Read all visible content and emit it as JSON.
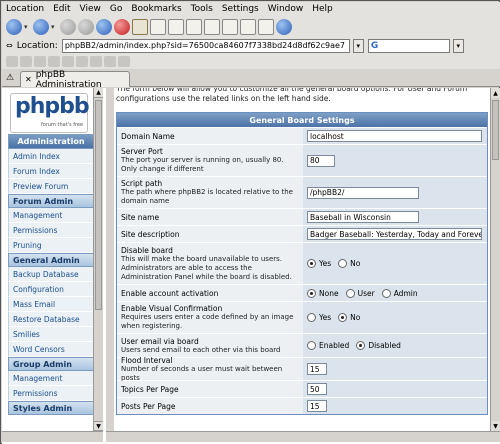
{
  "menu": [
    "Location",
    "Edit",
    "View",
    "Go",
    "Bookmarks",
    "Tools",
    "Settings",
    "Window",
    "Help"
  ],
  "location": {
    "label": "Location:",
    "url": "phpBB2/admin/index.php?sid=76500ca84607f7338bd24d8df62c9ae7",
    "search_placeholder": "G"
  },
  "tab": {
    "title": "phpBB Administration"
  },
  "logo": {
    "text": "phpbb",
    "tagline": "forum that's free"
  },
  "sidebar": {
    "header": "Administration",
    "sections": [
      {
        "title": null,
        "items": [
          "Admin Index",
          "Forum Index",
          "Preview Forum"
        ]
      },
      {
        "title": "Forum Admin",
        "items": [
          "Management",
          "Permissions",
          "Pruning"
        ]
      },
      {
        "title": "General Admin",
        "items": [
          "Backup Database",
          "Configuration",
          "Mass Email",
          "Restore Database",
          "Smilies",
          "Word Censors"
        ]
      },
      {
        "title": "Group Admin",
        "items": [
          "Management",
          "Permissions"
        ]
      },
      {
        "title": "Styles Admin",
        "items": []
      }
    ]
  },
  "intro_text": "The form below will allow you to customize all the general board options. For User and Forum configurations use the related links on the left hand side.",
  "settings": {
    "title": "General Board Settings",
    "domain_name": {
      "label": "Domain Name",
      "value": "localhost"
    },
    "server_port": {
      "label": "Server Port",
      "desc": "The port your server is running on, usually 80. Only change if different",
      "value": "80"
    },
    "script_path": {
      "label": "Script path",
      "desc": "The path where phpBB2 is located relative to the domain name",
      "value": "/phpBB2/"
    },
    "site_name": {
      "label": "Site name",
      "value": "Baseball in Wisconsin"
    },
    "site_description": {
      "label": "Site description",
      "value": "Badger Baseball: Yesterday, Today and Forever"
    },
    "disable_board": {
      "label": "Disable board",
      "desc": "This will make the board unavailable to users. Administrators are able to access the Administration Panel while the board is disabled.",
      "options": [
        "Yes",
        "No"
      ],
      "selected": "Yes"
    },
    "account_activation": {
      "label": "Enable account activation",
      "options": [
        "None",
        "User",
        "Admin"
      ],
      "selected": "None"
    },
    "visual_confirmation": {
      "label": "Enable Visual Confirmation",
      "desc": "Requires users enter a code defined by an image when registering.",
      "options": [
        "Yes",
        "No"
      ],
      "selected": "No"
    },
    "email_via_board": {
      "label": "User email via board",
      "desc": "Users send email to each other via this board",
      "options": [
        "Enabled",
        "Disabled"
      ],
      "selected": "Disabled"
    },
    "flood_interval": {
      "label": "Flood Interval",
      "desc": "Number of seconds a user must wait between posts",
      "value": "15"
    },
    "topics_per_page": {
      "label": "Topics Per Page",
      "value": "50"
    },
    "posts_per_page": {
      "label": "Posts Per Page",
      "value": "15"
    }
  }
}
